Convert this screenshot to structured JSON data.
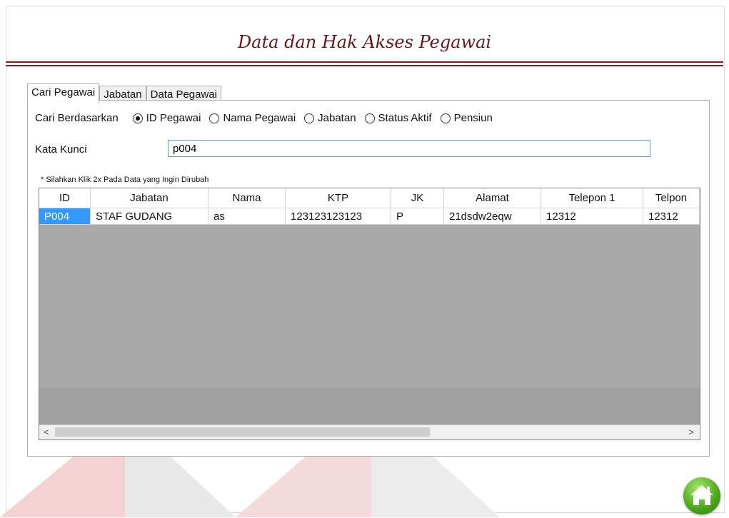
{
  "title": "Data dan Hak Akses Pegawai",
  "tabs": [
    "Cari Pegawai",
    "Jabatan",
    "Data Pegawai"
  ],
  "search": {
    "label": "Cari Berdasarkan",
    "options": [
      "ID Pegawai",
      "Nama Pegawai",
      "Jabatan",
      "Status Aktif",
      "Pensiun"
    ],
    "selected": "ID Pegawai",
    "keyword_label": "Kata Kunci",
    "keyword_value": "p004"
  },
  "hint": "* Silahkan Klik 2x Pada Data yang Ingin Dirubah",
  "table": {
    "columns": [
      "ID",
      "Jabatan",
      "Nama",
      "KTP",
      "JK",
      "Alamat",
      "Telepon 1",
      "Telpon"
    ],
    "rows": [
      [
        "P004",
        "STAF GUDANG",
        "as",
        "123123123123",
        "P",
        "21dsdw2eqw",
        "12312",
        "12312"
      ]
    ]
  },
  "scroll": {
    "left_arrow": "<",
    "right_arrow": ">"
  },
  "colors": {
    "title": "#6e1414",
    "rule": "#8a1a1a",
    "selection": "#3399ff",
    "home_button": "#4aa51a"
  },
  "icons": {
    "home": "home-icon"
  }
}
